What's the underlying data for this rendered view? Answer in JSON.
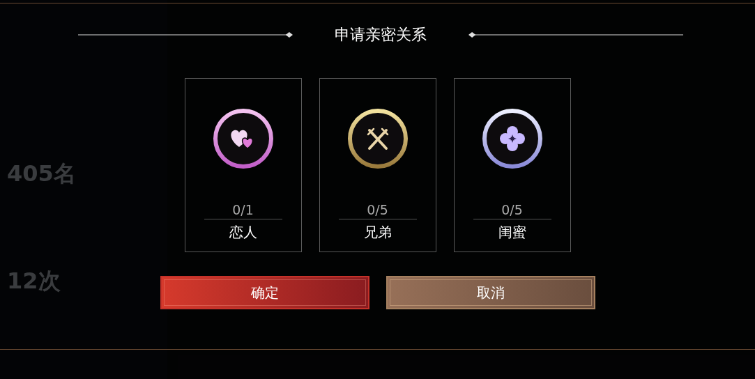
{
  "background": {
    "stats": [
      {
        "value": "405名"
      },
      {
        "value": "12次"
      }
    ]
  },
  "dialog": {
    "title": "申请亲密关系",
    "relations": [
      {
        "kind": "heart",
        "count": "0/1",
        "label": "恋人"
      },
      {
        "kind": "swords",
        "count": "0/5",
        "label": "兄弟"
      },
      {
        "kind": "flower",
        "count": "0/5",
        "label": "闺蜜"
      }
    ],
    "buttons": [
      {
        "kind": "confirm",
        "label": "确定"
      },
      {
        "kind": "cancel",
        "label": "取消"
      }
    ]
  }
}
